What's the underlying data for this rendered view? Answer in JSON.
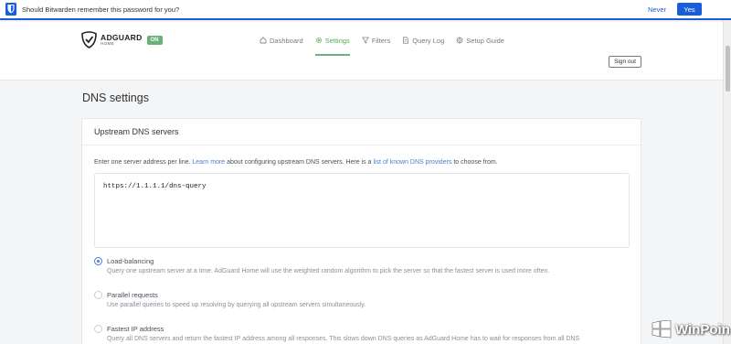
{
  "bitwarden": {
    "prompt": "Should Bitwarden remember this password for you?",
    "never_label": "Never",
    "yes_label": "Yes"
  },
  "header": {
    "brand_name": "ADGUARD",
    "brand_sub": "HOME",
    "status_badge": "ON",
    "nav": [
      {
        "label": "Dashboard",
        "icon": "home-icon",
        "active": false
      },
      {
        "label": "Settings",
        "icon": "gear-icon",
        "active": true
      },
      {
        "label": "Filters",
        "icon": "filter-icon",
        "active": false
      },
      {
        "label": "Query Log",
        "icon": "document-icon",
        "active": false
      },
      {
        "label": "Setup Guide",
        "icon": "globe-icon",
        "active": false
      }
    ],
    "signout_label": "Sign out"
  },
  "page": {
    "title": "DNS settings"
  },
  "upstream": {
    "title": "Upstream DNS servers",
    "desc_1": "Enter one server address per line. ",
    "desc_link_1": "Learn more",
    "desc_2": " about configuring upstream DNS servers. Here is a ",
    "desc_link_2": "list of known DNS providers",
    "desc_3": " to choose from.",
    "servers_value": "https://1.1.1.1/dns-query",
    "options": [
      {
        "title": "Load-balancing",
        "desc": "Query one upstream server at a time. AdGuard Home will use the weighted random algorithm to pick the server so that the fastest server is used more often.",
        "checked": true
      },
      {
        "title": "Parallel requests",
        "desc": "Use parallel queries to speed up resolving by querying all upstream servers simultaneously.",
        "checked": false
      },
      {
        "title": "Fastest IP address",
        "desc": "Query all DNS servers and return the fastest IP address among all responses. This slows down DNS queries as AdGuard Home has to wait for responses from all DNS",
        "checked": false
      }
    ]
  },
  "watermark": {
    "text": "WinPoin"
  },
  "colors": {
    "accent_green": "#67b279",
    "link_blue": "#467fcf",
    "bitwarden_blue": "#175ddc"
  }
}
